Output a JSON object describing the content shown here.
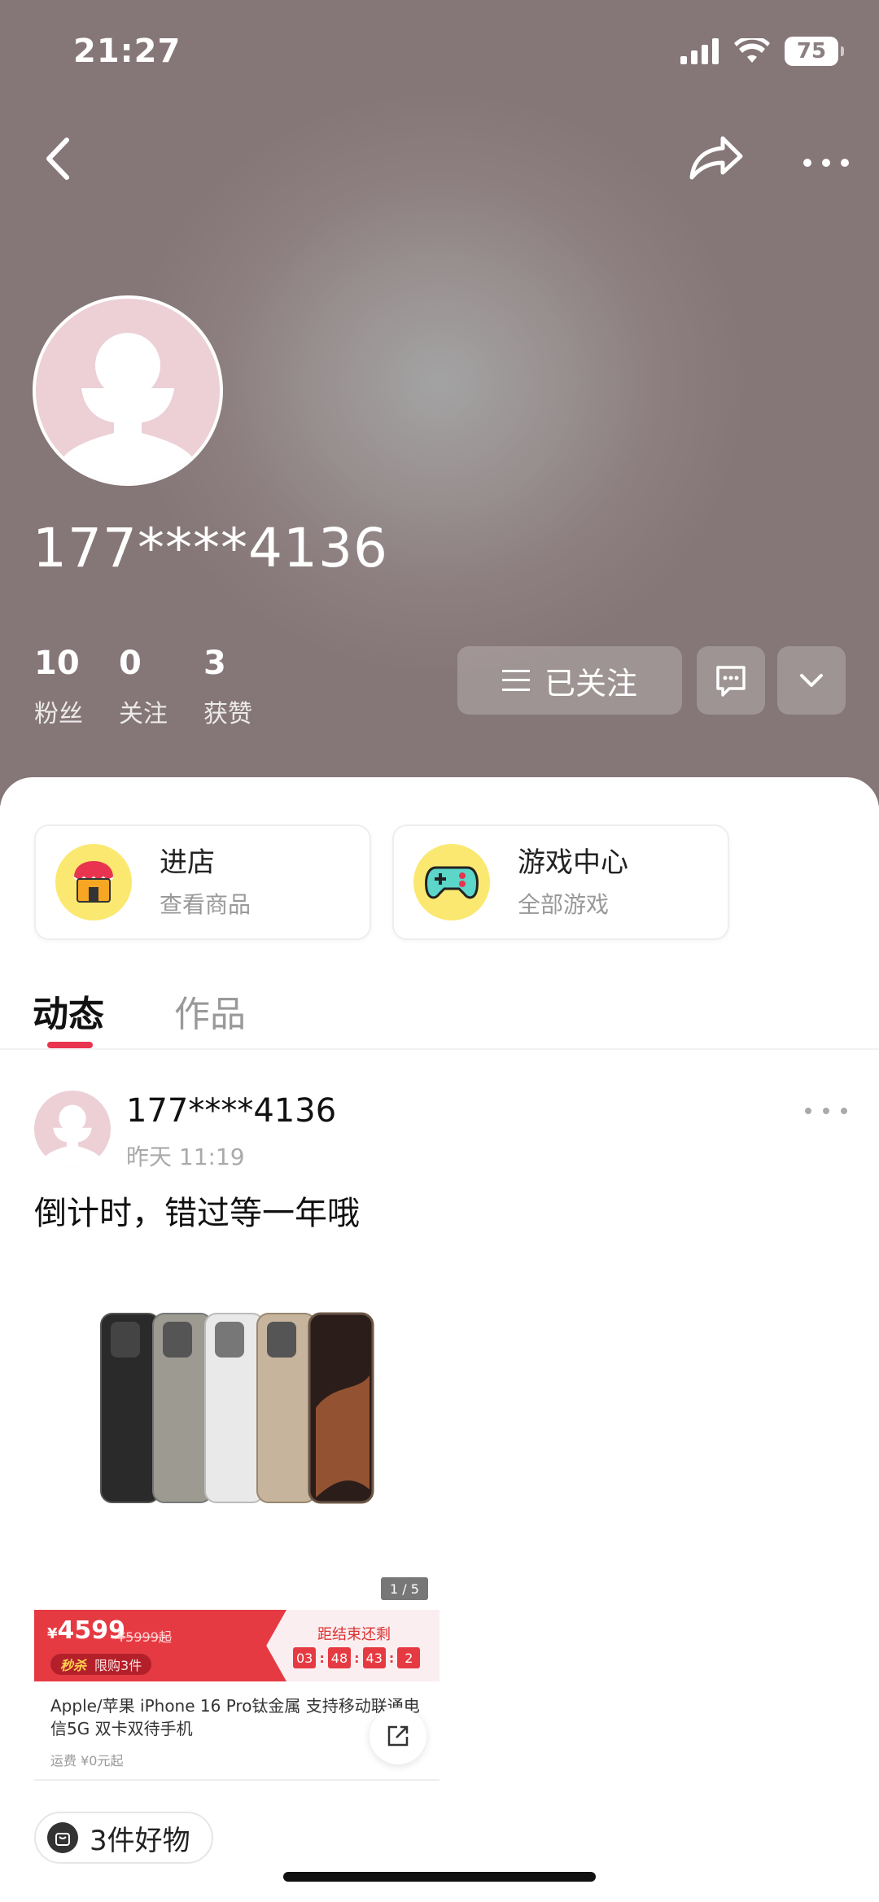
{
  "status_bar": {
    "time": "21:27",
    "battery": "75"
  },
  "profile": {
    "username": "177****4136",
    "stats": [
      {
        "value": "10",
        "label": "粉丝"
      },
      {
        "value": "0",
        "label": "关注"
      },
      {
        "value": "3",
        "label": "获赞"
      }
    ],
    "follow_button_label": "已关注"
  },
  "shortcuts": [
    {
      "title": "进店",
      "subtitle": "查看商品",
      "icon": "shop-icon"
    },
    {
      "title": "游戏中心",
      "subtitle": "全部游戏",
      "icon": "gamepad-icon"
    }
  ],
  "tabs": [
    {
      "label": "动态",
      "active": true
    },
    {
      "label": "作品",
      "active": false
    }
  ],
  "post": {
    "author": "177****4136",
    "time": "昨天 11:19",
    "text": "倒计时，错过等一年哦",
    "image_pager": "1 / 5"
  },
  "product": {
    "currency": "¥",
    "price": "4599",
    "original_price": "¥5999起",
    "flash_tag": "秒杀",
    "limit_text": "限购3件",
    "countdown_label": "距结束还剩",
    "countdown": [
      "03",
      "48",
      "43",
      "2"
    ],
    "title": "Apple/苹果 iPhone 16 Pro钛金属 支持移动联通电信5G 双卡双待手机",
    "shipping": "运费 ¥0元起"
  },
  "goods_pill": "3件好物",
  "colors": {
    "accent": "#e8344e",
    "promo_red": "#e63a42",
    "hero": "#8d7f80"
  }
}
